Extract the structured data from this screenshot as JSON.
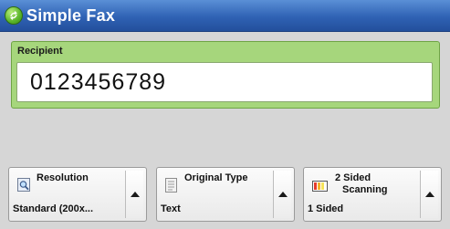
{
  "app": {
    "title": "Simple Fax",
    "icon": "fax-app-icon"
  },
  "recipient": {
    "label": "Recipient",
    "value": "0123456789"
  },
  "features": [
    {
      "label": "Resolution",
      "value": "Standard (200x...",
      "icon": "resolution-magnifier-icon"
    },
    {
      "label": "Original Type",
      "value": "Text",
      "icon": "document-icon"
    },
    {
      "label_line1": "2 Sided",
      "label_line2": "Scanning",
      "value": "1 Sided",
      "icon": "two-sided-scanning-icon"
    }
  ],
  "colors": {
    "titlebar": "#2f62b4",
    "recipient_panel": "#a6d67c",
    "background": "#d6d6d6"
  }
}
